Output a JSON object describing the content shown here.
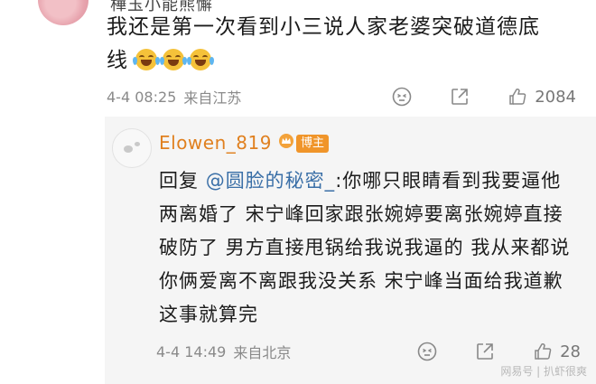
{
  "top_comment": {
    "username_cut": "樺玉小能熊懈",
    "text": "我还是第一次看到小三说人家老婆突破道德底线",
    "emojis": [
      "laugh-cry-emoji",
      "laugh-cry-emoji",
      "laugh-cry-emoji"
    ],
    "time": "4-4 08:25",
    "source": "来自江苏",
    "like_count": "2084"
  },
  "reply": {
    "username": "Elowen_819",
    "badge": "博主",
    "reply_prefix": "回复",
    "mention": "@圆脸的秘密_",
    "text": ":你哪只眼睛看到我要逼他两离婚了 宋宁峰回家跟张婉婷要离张婉婷直接破防了 男方直接甩锅给我说我逼的 我从来都说你俩爱离不离跟我没关系 宋宁峰当面给我道歉这事就算完",
    "time": "4-4 14:49",
    "source": "来自北京",
    "like_count": "28"
  },
  "watermark": "网易号 | 扒虾很爽",
  "colors": {
    "username": "#e0801f",
    "mention": "#3a6fa7",
    "reply_bg": "#f5f5f5",
    "meta": "#8a8a8a"
  }
}
